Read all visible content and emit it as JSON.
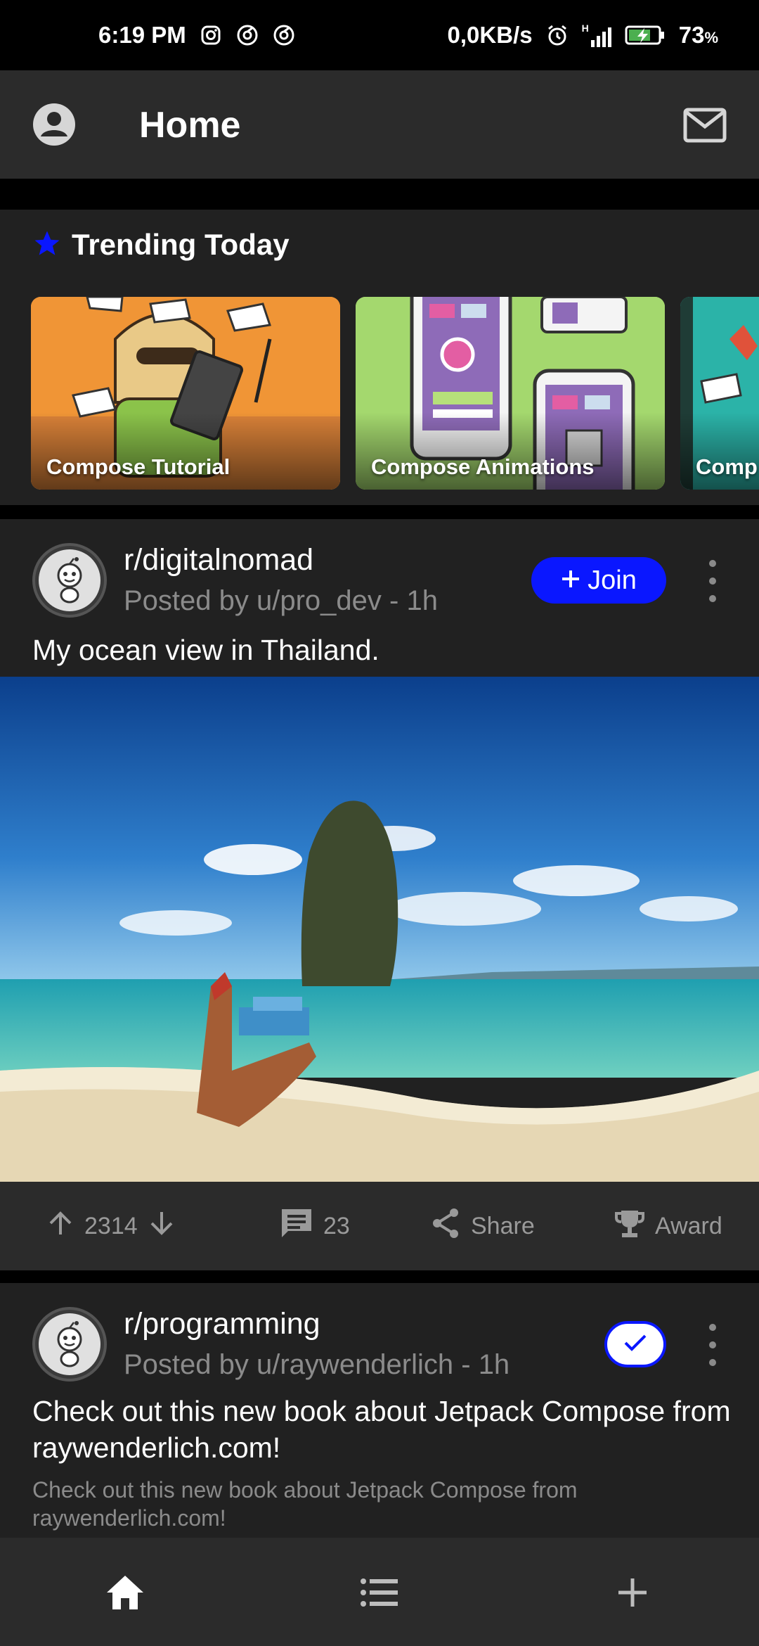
{
  "status_bar": {
    "time": "6:19 PM",
    "net_speed": "0,0KB/s",
    "network_type": "H",
    "battery": "73",
    "battery_unit": "%"
  },
  "app_bar": {
    "title": "Home",
    "left_icon": "account-circle-icon",
    "right_icon": "mail-icon"
  },
  "trending": {
    "title": "Trending Today",
    "icon": "star-icon",
    "icon_color": "#0a17ff",
    "items": [
      {
        "label": "Compose Tutorial"
      },
      {
        "label": "Compose Animations"
      },
      {
        "label": "Comp"
      }
    ]
  },
  "posts": [
    {
      "subreddit": "r/digitalnomad",
      "posted_by": "Posted by u/pro_dev - 1h",
      "join_label": "Join",
      "title": "My ocean view in Thailand.",
      "votes": "2314",
      "comments": "23",
      "share_label": "Share",
      "award_label": "Award"
    },
    {
      "subreddit": "r/programming",
      "posted_by": "Posted by u/raywenderlich - 1h",
      "title": "Check out this new book about Jetpack Compose from raywenderlich.com!",
      "body": "Check out this new book about Jetpack Compose from raywenderlich.com!",
      "joined": true
    }
  ],
  "bottom_nav": {
    "items": [
      {
        "icon": "home-icon",
        "active": true
      },
      {
        "icon": "list-icon",
        "active": false
      },
      {
        "icon": "add-icon",
        "active": false
      }
    ]
  },
  "colors": {
    "accent": "#0a17ff",
    "surface": "#212121",
    "bar": "#2b2b2b",
    "muted_text": "#8b8b8b"
  }
}
